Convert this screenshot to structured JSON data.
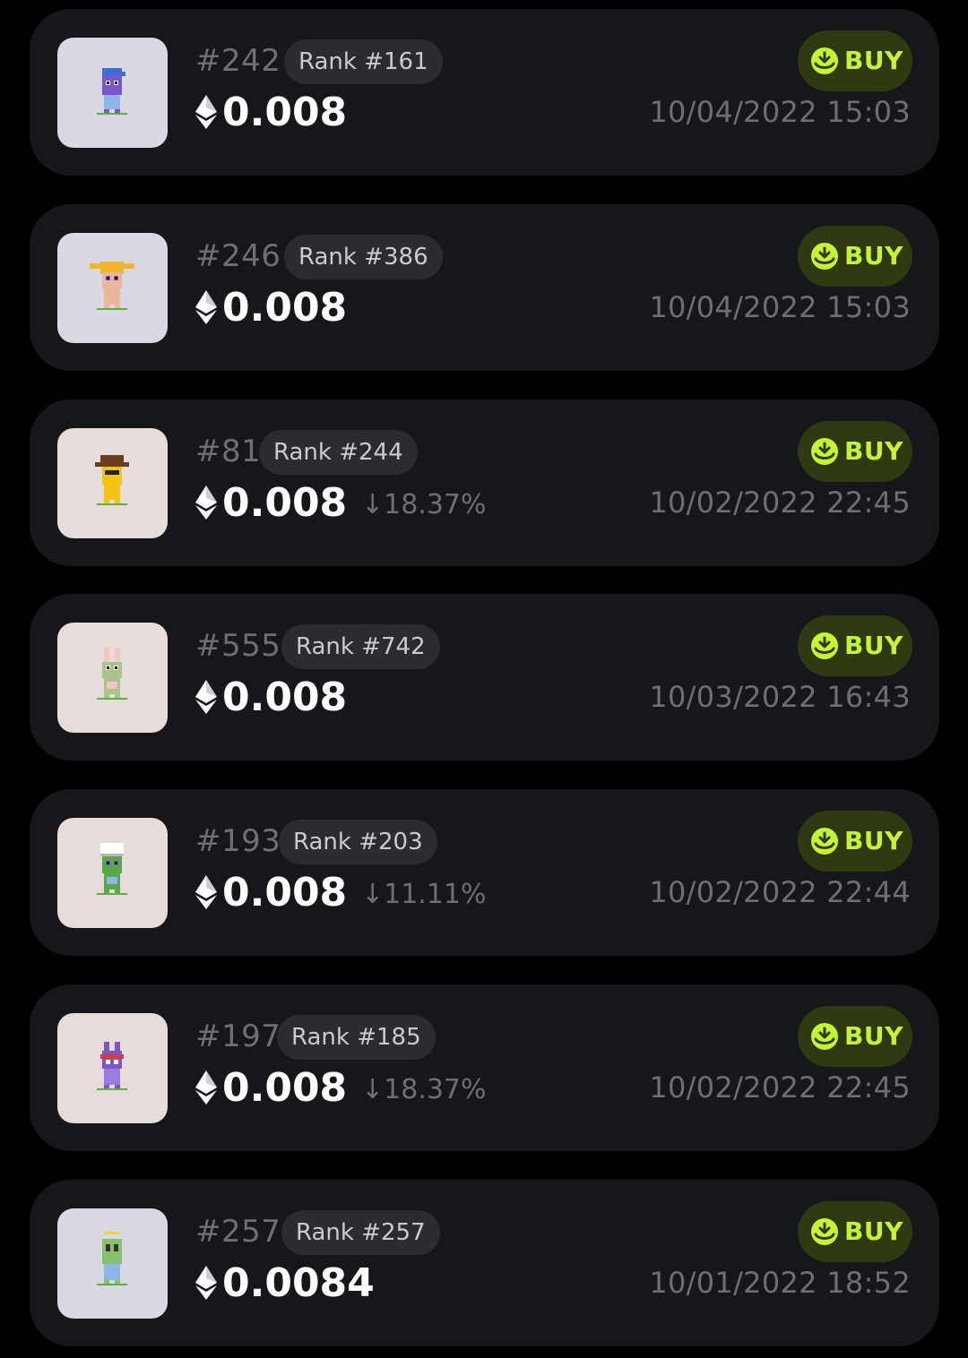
{
  "colors": {
    "background": "#000000",
    "card": "#16171b",
    "pill": "#2b2c31",
    "buy_bg": "#2f3a10",
    "buy_fg": "#c6f432",
    "muted": "#6d6f75"
  },
  "listings": [
    {
      "id": "#242",
      "rank": "Rank #161",
      "price": "0.008",
      "change": "",
      "buy_label": "BUY",
      "timestamp": "10/04/2022 15:03",
      "thumb_bg": "#d9d9e3",
      "avatar": "blue-cap-purple-character"
    },
    {
      "id": "#246",
      "rank": "Rank #386",
      "price": "0.008",
      "change": "",
      "buy_label": "BUY",
      "timestamp": "10/04/2022 15:03",
      "thumb_bg": "#d9d9e3",
      "avatar": "yellow-pigtails-character"
    },
    {
      "id": "#81",
      "rank": "Rank #244",
      "price": "0.008",
      "change": "↓18.37%",
      "buy_label": "BUY",
      "timestamp": "10/02/2022 22:45",
      "thumb_bg": "#e6dcd9",
      "avatar": "cowboy-hat-yellow-character"
    },
    {
      "id": "#555",
      "rank": "Rank #742",
      "price": "0.008",
      "change": "",
      "buy_label": "BUY",
      "timestamp": "10/03/2022 16:43",
      "thumb_bg": "#e6dcd9",
      "avatar": "bunny-ears-green-character"
    },
    {
      "id": "#193",
      "rank": "Rank #203",
      "price": "0.008",
      "change": "↓11.11%",
      "buy_label": "BUY",
      "timestamp": "10/02/2022 22:44",
      "thumb_bg": "#e6dcd9",
      "avatar": "chef-hat-green-character"
    },
    {
      "id": "#197",
      "rank": "Rank #185",
      "price": "0.008",
      "change": "↓18.37%",
      "buy_label": "BUY",
      "timestamp": "10/02/2022 22:45",
      "thumb_bg": "#e6dcd9",
      "avatar": "red-bandana-purple-character"
    },
    {
      "id": "#257",
      "rank": "Rank #257",
      "price": "0.0084",
      "change": "",
      "buy_label": "BUY",
      "timestamp": "10/01/2022 18:52",
      "thumb_bg": "#d9d9e3",
      "avatar": "halo-green-character"
    }
  ]
}
